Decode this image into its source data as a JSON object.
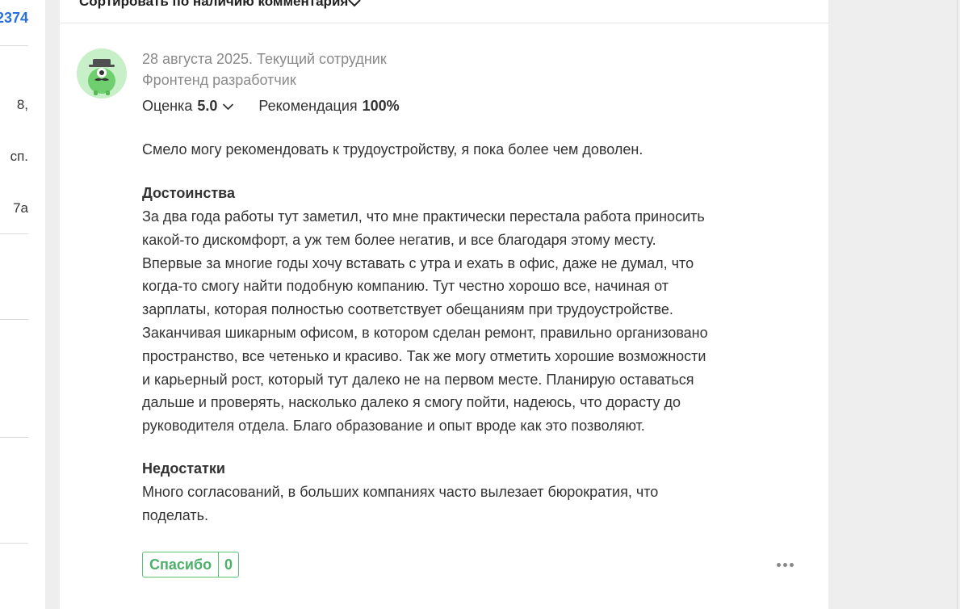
{
  "left_column": {
    "top_number": "2374",
    "fragments": [
      "8,",
      "сп.",
      "7а"
    ]
  },
  "sort": {
    "label": "Сортировать по наличию комментария",
    "icon": "chevron-down-icon"
  },
  "review": {
    "avatar_icon": "spy-monster-avatar",
    "date_status": "28 августа 2025. Текущий сотрудник",
    "position": "Фронтенд разработчик",
    "rating_label": "Оценка",
    "rating_value": "5.0",
    "recommendation_label": "Рекомендация",
    "recommendation_value": "100%",
    "summary": "Смело могу рекомендовать к трудоустройству, я пока более чем доволен.",
    "pros_title": "Достоинства",
    "pros_text": "За два года работы тут заметил, что мне практически перестала работа приносить какой-то дискомфорт, а уж тем более негатив, и все благодаря этому месту. Впервые за многие годы хочу вставать с утра и ехать в офис, даже не думал, что когда-то смогу найти подобную компанию. Тут честно хорошо все, начиная от зарплаты, которая полностью соответствует обещаниям при трудоустройстве. Заканчивая шикарным офисом, в котором сделан ремонт, правильно организовано пространство, все четенько и красиво. Так же могу отметить хорошие возможности и карьерный рост, который тут далеко не на первом месте. Планирую оставаться дальше и проверять, насколько далеко я смогу пойти, надеюсь, что дорасту до руководителя отдела. Благо образование и опыт вроде как это позволяют.",
    "cons_title": "Недостатки",
    "cons_text": "Много согласований, в больших компаниях часто вылезает бюрократия, что поделать.",
    "thanks_label": "Спасибо",
    "thanks_count": "0",
    "more_icon": "more-dots-icon"
  },
  "colors": {
    "link_blue": "#2a6fd6",
    "thanks_green": "#4caf6a",
    "avatar_bg": "#c8f0c8"
  }
}
